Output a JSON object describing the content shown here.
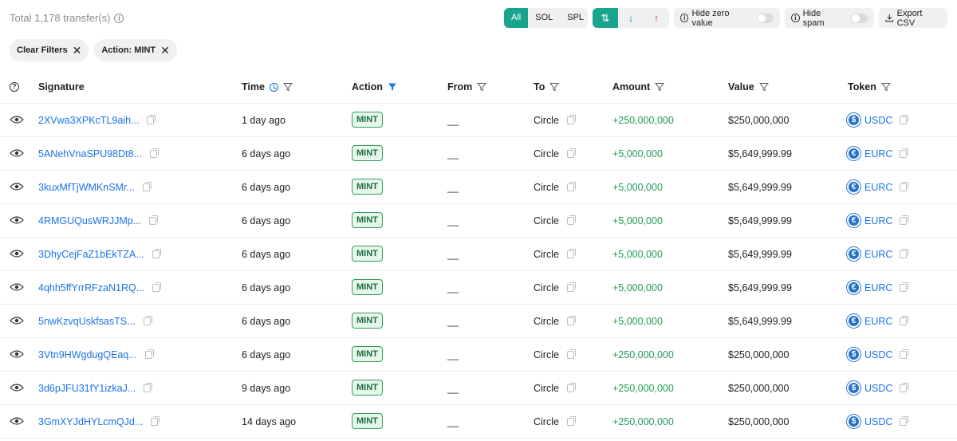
{
  "header": {
    "total_text": "Total 1,178 transfer(s)",
    "filter_options": [
      "All",
      "SOL",
      "SPL"
    ],
    "active_filter": "All",
    "direction_options": [
      "⇅",
      "↓",
      "↑"
    ],
    "hide_zero_label": "Hide zero value",
    "hide_spam_label": "Hide spam",
    "export_label": "Export CSV"
  },
  "chips": {
    "clear_label": "Clear Filters",
    "action_label": "Action: MINT"
  },
  "columns": {
    "signature": "Signature",
    "time": "Time",
    "action": "Action",
    "from": "From",
    "to": "To",
    "amount": "Amount",
    "value": "Value",
    "token": "Token"
  },
  "rows": [
    {
      "signature": "2XVwa3XPKcTL9aih...",
      "time": "1 day ago",
      "action": "MINT",
      "from": "__",
      "to": "Circle",
      "amount": "+250,000,000",
      "value": "$250,000,000",
      "token": "USDC",
      "token_symbol": "$"
    },
    {
      "signature": "5ANehVnaSPU98Dt8...",
      "time": "6 days ago",
      "action": "MINT",
      "from": "__",
      "to": "Circle",
      "amount": "+5,000,000",
      "value": "$5,649,999.99",
      "token": "EURC",
      "token_symbol": "€"
    },
    {
      "signature": "3kuxMfTjWMKnSMr...",
      "time": "6 days ago",
      "action": "MINT",
      "from": "__",
      "to": "Circle",
      "amount": "+5,000,000",
      "value": "$5,649,999.99",
      "token": "EURC",
      "token_symbol": "€"
    },
    {
      "signature": "4RMGUQusWRJJMp...",
      "time": "6 days ago",
      "action": "MINT",
      "from": "__",
      "to": "Circle",
      "amount": "+5,000,000",
      "value": "$5,649,999.99",
      "token": "EURC",
      "token_symbol": "€"
    },
    {
      "signature": "3DhyCejFaZ1bEkTZA...",
      "time": "6 days ago",
      "action": "MINT",
      "from": "__",
      "to": "Circle",
      "amount": "+5,000,000",
      "value": "$5,649,999.99",
      "token": "EURC",
      "token_symbol": "€"
    },
    {
      "signature": "4qhh5ffYrrRFzaN1RQ...",
      "time": "6 days ago",
      "action": "MINT",
      "from": "__",
      "to": "Circle",
      "amount": "+5,000,000",
      "value": "$5,649,999.99",
      "token": "EURC",
      "token_symbol": "€"
    },
    {
      "signature": "5nwKzvqUskfsasTS...",
      "time": "6 days ago",
      "action": "MINT",
      "from": "__",
      "to": "Circle",
      "amount": "+5,000,000",
      "value": "$5,649,999.99",
      "token": "EURC",
      "token_symbol": "€"
    },
    {
      "signature": "3Vtn9HWgdugQEaq...",
      "time": "6 days ago",
      "action": "MINT",
      "from": "__",
      "to": "Circle",
      "amount": "+250,000,000",
      "value": "$250,000,000",
      "token": "USDC",
      "token_symbol": "$"
    },
    {
      "signature": "3d6pJFU31fY1izkaJ...",
      "time": "9 days ago",
      "action": "MINT",
      "from": "__",
      "to": "Circle",
      "amount": "+250,000,000",
      "value": "$250,000,000",
      "token": "USDC",
      "token_symbol": "$"
    },
    {
      "signature": "3GmXYJdHYLcmQJd...",
      "time": "14 days ago",
      "action": "MINT",
      "from": "__",
      "to": "Circle",
      "amount": "+250,000,000",
      "value": "$250,000,000",
      "token": "USDC",
      "token_symbol": "$"
    }
  ],
  "colors": {
    "accent": "#19a58d",
    "link": "#1a73e8",
    "positive": "#1f9d55",
    "coin": "#2775ca"
  }
}
